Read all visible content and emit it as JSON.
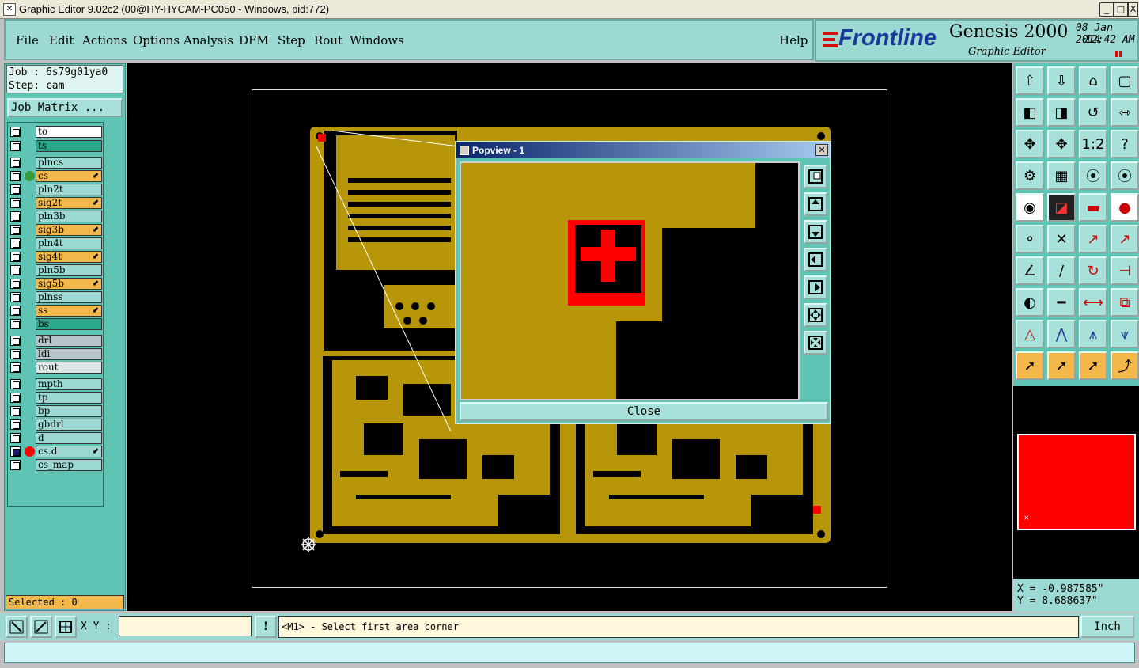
{
  "window": {
    "title": "Graphic Editor 9.02c2 (00@HY-HYCAM-PC050 - Windows, pid:772)",
    "controls": [
      "_",
      "□",
      "X"
    ]
  },
  "menu": {
    "items": [
      "File",
      "Edit",
      "Actions",
      "Options",
      "Analysis",
      "DFM",
      "Step",
      "Rout",
      "Windows"
    ],
    "help": "Help"
  },
  "brand": {
    "logo": "Frontline",
    "product": "Genesis 2000",
    "subtitle": "Graphic Editor",
    "date": "08 Jan 2014",
    "time": "12:42 AM"
  },
  "job": {
    "job_line": "Job : 6s79g01ya0",
    "step_line": "Step: cam",
    "matrix_button": "Job Matrix ..."
  },
  "layers": [
    {
      "name": "to",
      "color": "#ffffff",
      "checked": false
    },
    {
      "name": "ts",
      "color": "#2aa88a",
      "checked": false
    },
    {
      "name": "plncs",
      "color": "#9cd9d3",
      "checked": false
    },
    {
      "name": "cs",
      "color": "#f4b74a",
      "checked": false,
      "mark": "#3a9a3a",
      "editable": true
    },
    {
      "name": "pln2t",
      "color": "#9cd9d3",
      "checked": false
    },
    {
      "name": "sig2t",
      "color": "#f4b74a",
      "checked": false,
      "editable": true
    },
    {
      "name": "pln3b",
      "color": "#9cd9d3",
      "checked": false
    },
    {
      "name": "sig3b",
      "color": "#f4b74a",
      "checked": false,
      "editable": true
    },
    {
      "name": "pln4t",
      "color": "#9cd9d3",
      "checked": false
    },
    {
      "name": "sig4t",
      "color": "#f4b74a",
      "checked": false,
      "editable": true
    },
    {
      "name": "pln5b",
      "color": "#9cd9d3",
      "checked": false
    },
    {
      "name": "sig5b",
      "color": "#f4b74a",
      "checked": false,
      "editable": true
    },
    {
      "name": "plnss",
      "color": "#9cd9d3",
      "checked": false
    },
    {
      "name": "ss",
      "color": "#f4b74a",
      "checked": false,
      "editable": true
    },
    {
      "name": "bs",
      "color": "#2aa88a",
      "checked": false
    },
    {
      "name": "drl",
      "color": "#b8c4c8",
      "checked": false
    },
    {
      "name": "ldi",
      "color": "#b8c4c8",
      "checked": false
    },
    {
      "name": "rout",
      "color": "#dde6e6",
      "checked": false
    },
    {
      "name": "mpth",
      "color": "#9cd9d3",
      "checked": false
    },
    {
      "name": "tp",
      "color": "#9cd9d3",
      "checked": false
    },
    {
      "name": "bp",
      "color": "#9cd9d3",
      "checked": false
    },
    {
      "name": "gbdrl",
      "color": "#9cd9d3",
      "checked": false
    },
    {
      "name": "d",
      "color": "#9cd9d3",
      "checked": false
    },
    {
      "name": "cs.d",
      "color": "#9cd9d3",
      "checked": true,
      "mark": "#ff0000",
      "editable": true
    },
    {
      "name": "cs_map",
      "color": "#9cd9d3",
      "checked": false
    }
  ],
  "selected": "Selected : 0",
  "popview": {
    "title": "Popview - 1",
    "close_label": "Close"
  },
  "coords": {
    "x": "X = -0.987585\"",
    "y": "Y = 8.688637\""
  },
  "status": {
    "xy_label": "X Y :",
    "xy_value": "",
    "message": "<M1> - Select first area corner",
    "unit": "Inch"
  },
  "colors": {
    "copper": "#b8960a",
    "panel": "#5fc4b4",
    "highlight": "#ff0000"
  }
}
